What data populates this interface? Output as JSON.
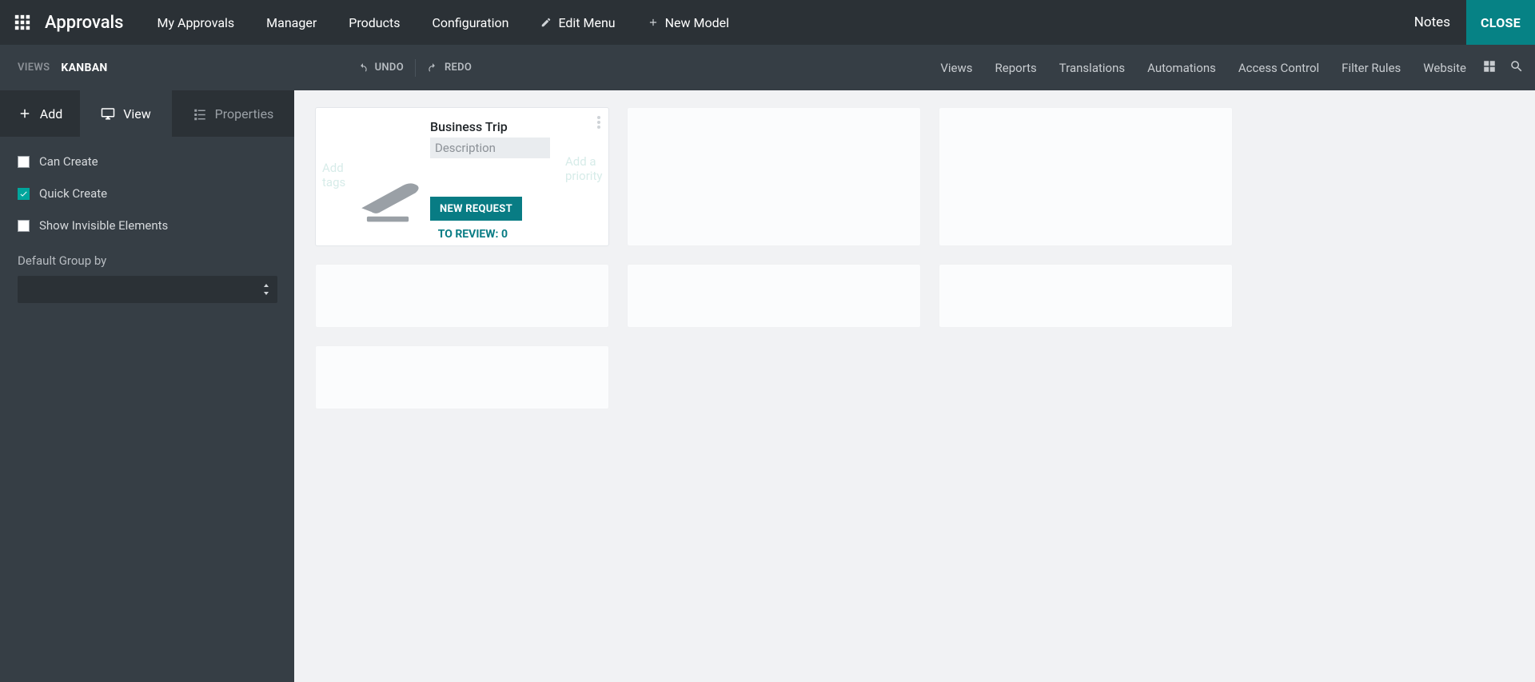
{
  "header": {
    "appTitle": "Approvals",
    "menu": [
      "My Approvals",
      "Manager",
      "Products",
      "Configuration"
    ],
    "editMenu": "Edit Menu",
    "newModel": "New Model",
    "notes": "Notes",
    "close": "CLOSE"
  },
  "secondary": {
    "viewsLabel": "VIEWS",
    "kanban": "KANBAN",
    "undo": "UNDO",
    "redo": "REDO",
    "tabs": [
      "Views",
      "Reports",
      "Translations",
      "Automations",
      "Access Control",
      "Filter Rules",
      "Website"
    ]
  },
  "sidebar": {
    "tabs": {
      "add": "Add",
      "view": "View",
      "properties": "Properties"
    },
    "options": {
      "canCreate": {
        "label": "Can Create",
        "checked": false
      },
      "quickCreate": {
        "label": "Quick Create",
        "checked": true
      },
      "showInvisible": {
        "label": "Show Invisible Elements",
        "checked": false
      }
    },
    "defaultGroupBy": {
      "label": "Default Group by",
      "value": ""
    }
  },
  "card": {
    "title": "Business Trip",
    "descriptionPlaceholder": "Description",
    "newRequest": "NEW REQUEST",
    "toReview": "TO REVIEW: 0",
    "ghostLeft": "Add tags",
    "ghostRight": "Add a priority"
  }
}
